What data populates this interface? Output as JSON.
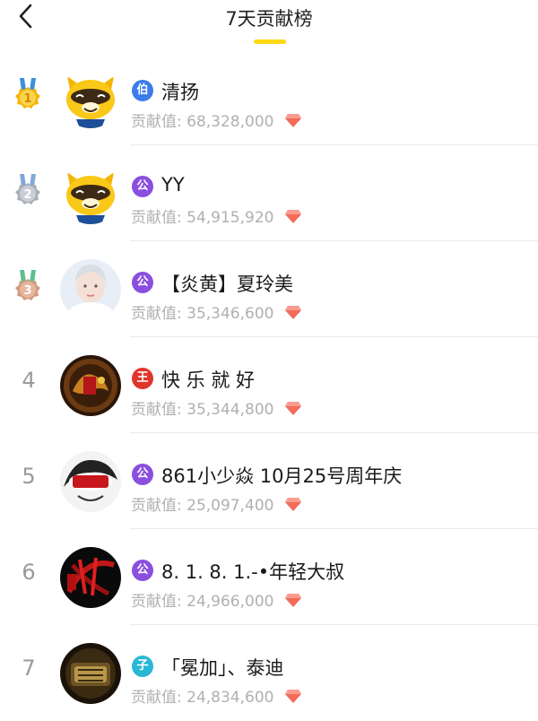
{
  "header": {
    "title": "7天贡献榜",
    "accent_color": "#FFD814"
  },
  "contribution_label": "贡献值: ",
  "ranking": [
    {
      "rank": "1",
      "medal": "gold",
      "badge_text": "伯",
      "badge_color": "#3b7bea",
      "name": "清扬",
      "value": "68,328,000",
      "avatar": "yy-raccoon-mascot"
    },
    {
      "rank": "2",
      "medal": "silver",
      "badge_text": "公",
      "badge_color": "#8a4fe0",
      "name": "YY",
      "value": "54,915,920",
      "avatar": "yy-raccoon-mascot"
    },
    {
      "rank": "3",
      "medal": "bronze",
      "badge_text": "公",
      "badge_color": "#8a4fe0",
      "name": "【炎黄】夏玲美",
      "value": "35,346,600",
      "avatar": "woman-portrait"
    },
    {
      "rank": "4",
      "medal": "",
      "badge_text": "王",
      "badge_color": "#e0352b",
      "name": "快 乐 就 好",
      "value": "35,344,800",
      "avatar": "dragon-emblem"
    },
    {
      "rank": "5",
      "medal": "",
      "badge_text": "公",
      "badge_color": "#8a4fe0",
      "name": "861小少焱 10月25号周年庆",
      "value": "25,097,400",
      "avatar": "861-logo"
    },
    {
      "rank": "6",
      "medal": "",
      "badge_text": "公",
      "badge_color": "#8a4fe0",
      "name": "8. 1. 8. 1.-•年轻大叔",
      "value": "24,966,000",
      "avatar": "red-calligraphy-logo"
    },
    {
      "rank": "7",
      "medal": "",
      "badge_text": "子",
      "badge_color": "#2ab6d6",
      "name": "「冕加」、泰迪",
      "value": "24,834,600",
      "avatar": "gold-emblem-logo"
    }
  ]
}
